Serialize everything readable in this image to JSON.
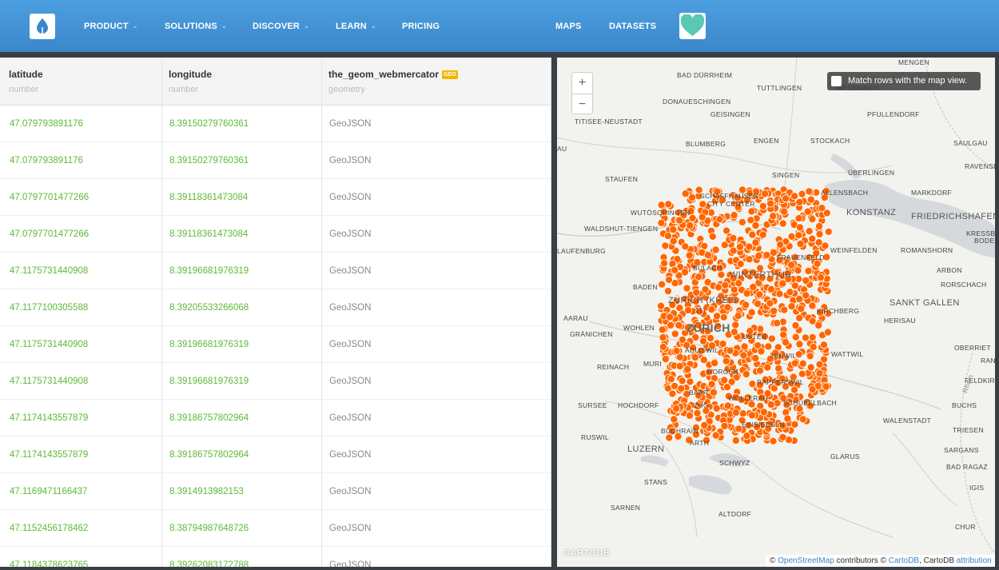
{
  "nav": {
    "logo_icon": "carto-drop-icon",
    "items": [
      {
        "label": "PRODUCT",
        "chevron": true
      },
      {
        "label": "SOLUTIONS",
        "chevron": true
      },
      {
        "label": "DISCOVER",
        "chevron": true
      },
      {
        "label": "LEARN",
        "chevron": true
      },
      {
        "label": "PRICING",
        "chevron": false
      }
    ],
    "maps_label": "MAPS",
    "datasets_label": "DATASETS",
    "heart_icon": "heart-icon",
    "accent_color": "#3b87cb"
  },
  "table": {
    "columns": [
      {
        "name": "latitude",
        "type": "number"
      },
      {
        "name": "longitude",
        "type": "number"
      },
      {
        "name": "the_geom_webmercator",
        "type": "geometry",
        "badge": "GEO"
      }
    ],
    "rows": [
      [
        "47.079793891176",
        "8.39150279760361",
        "GeoJSON"
      ],
      [
        "47.079793891176",
        "8.39150279760361",
        "GeoJSON"
      ],
      [
        "47.0797701477266",
        "8.39118361473084",
        "GeoJSON"
      ],
      [
        "47.0797701477266",
        "8.39118361473084",
        "GeoJSON"
      ],
      [
        "47.1175731440908",
        "8.39196681976319",
        "GeoJSON"
      ],
      [
        "47.1177100305588",
        "8.39205533266068",
        "GeoJSON"
      ],
      [
        "47.1175731440908",
        "8.39196681976319",
        "GeoJSON"
      ],
      [
        "47.1175731440908",
        "8.39196681976319",
        "GeoJSON"
      ],
      [
        "47.1174143557879",
        "8.39186757802964",
        "GeoJSON"
      ],
      [
        "47.1174143557879",
        "8.39186757802964",
        "GeoJSON"
      ],
      [
        "47.1169471166437",
        "8.3914913982153",
        "GeoJSON"
      ],
      [
        "47.1152456178462",
        "8.38794987648726",
        "GeoJSON"
      ],
      [
        "47.1184378623765",
        "8.39262083172788",
        "GeoJSON"
      ]
    ],
    "value_color": "#5dba37"
  },
  "map": {
    "zoom_in": "+",
    "zoom_out": "−",
    "match_rows_label": "Match rows with the map view.",
    "watermark": "CARTODB",
    "attribution": {
      "prefix": "©",
      "osm": "OpenStreetMap",
      "middle": "contributors ©",
      "carto": "CartoDB",
      "suffix": ", CartoDB",
      "attribution_link": "attribution"
    },
    "point_color": "#ff6600",
    "places": [
      "MENGEN",
      "BAD DÜRRHEIM",
      "TUTTLINGEN",
      "MESSKIRCH",
      "DONAUESCHINGEN",
      "GEISINGEN",
      "PFULLENDORF",
      "TITISEE-NEUSTADT",
      "BLUMBERG",
      "ENGEN",
      "STOCKACH",
      "SAULGAU",
      "AU",
      "RAVENSB",
      "ÜBERLINGEN",
      "STAUFEN",
      "SINGEN",
      "SCHAFFHAUSEN",
      "ALLENSBACH",
      "MARKDORF",
      "CITY CENTER",
      "WUTÖSCHINGEN",
      "KONSTANZ",
      "FRIEDRICHSHAFEN",
      "WALDSHUT-TIENGEN",
      "KRESSBRON",
      "BODENS",
      "LAUFENBURG",
      "FRAUENFELD",
      "WEINFELDEN",
      "ROMANSHORN",
      "BÜLACH",
      "ARBON",
      "WINTERTHUR",
      "BADEN",
      "RORSCHACH",
      "ZÜRICH (KREIS",
      "11)",
      "KIRCHBERG",
      "SANKT GALLEN",
      "AARAU",
      "ZÜRICH",
      "HERISAU",
      "WOHLEN",
      "GRÄNICHEN",
      "USTER",
      "OBERRIET",
      "ADLISWIL",
      "HINWIL",
      "WATTWIL",
      "RANK",
      "REINACH",
      "MURI",
      "HORGEN",
      "FELDKIRG",
      "RAPPERSWIL",
      "BAAR",
      "WOLLERAU",
      "SURSEE",
      "HOCHDORF",
      "ZUG",
      "SCHÜBELBACH",
      "BUCHS",
      "BUCHRAIN",
      "EINSIEDELN",
      "WALENSTADT",
      "RUSWIL",
      "TRIESEN",
      "ARTH",
      "LUZERN",
      "SARGANS",
      "GLARUS",
      "SCHWYZ",
      "BAD RAGAZ",
      "STANS",
      "IGIS",
      "SARNEN",
      "ALTDORF",
      "CHUR",
      "Rhein"
    ]
  }
}
